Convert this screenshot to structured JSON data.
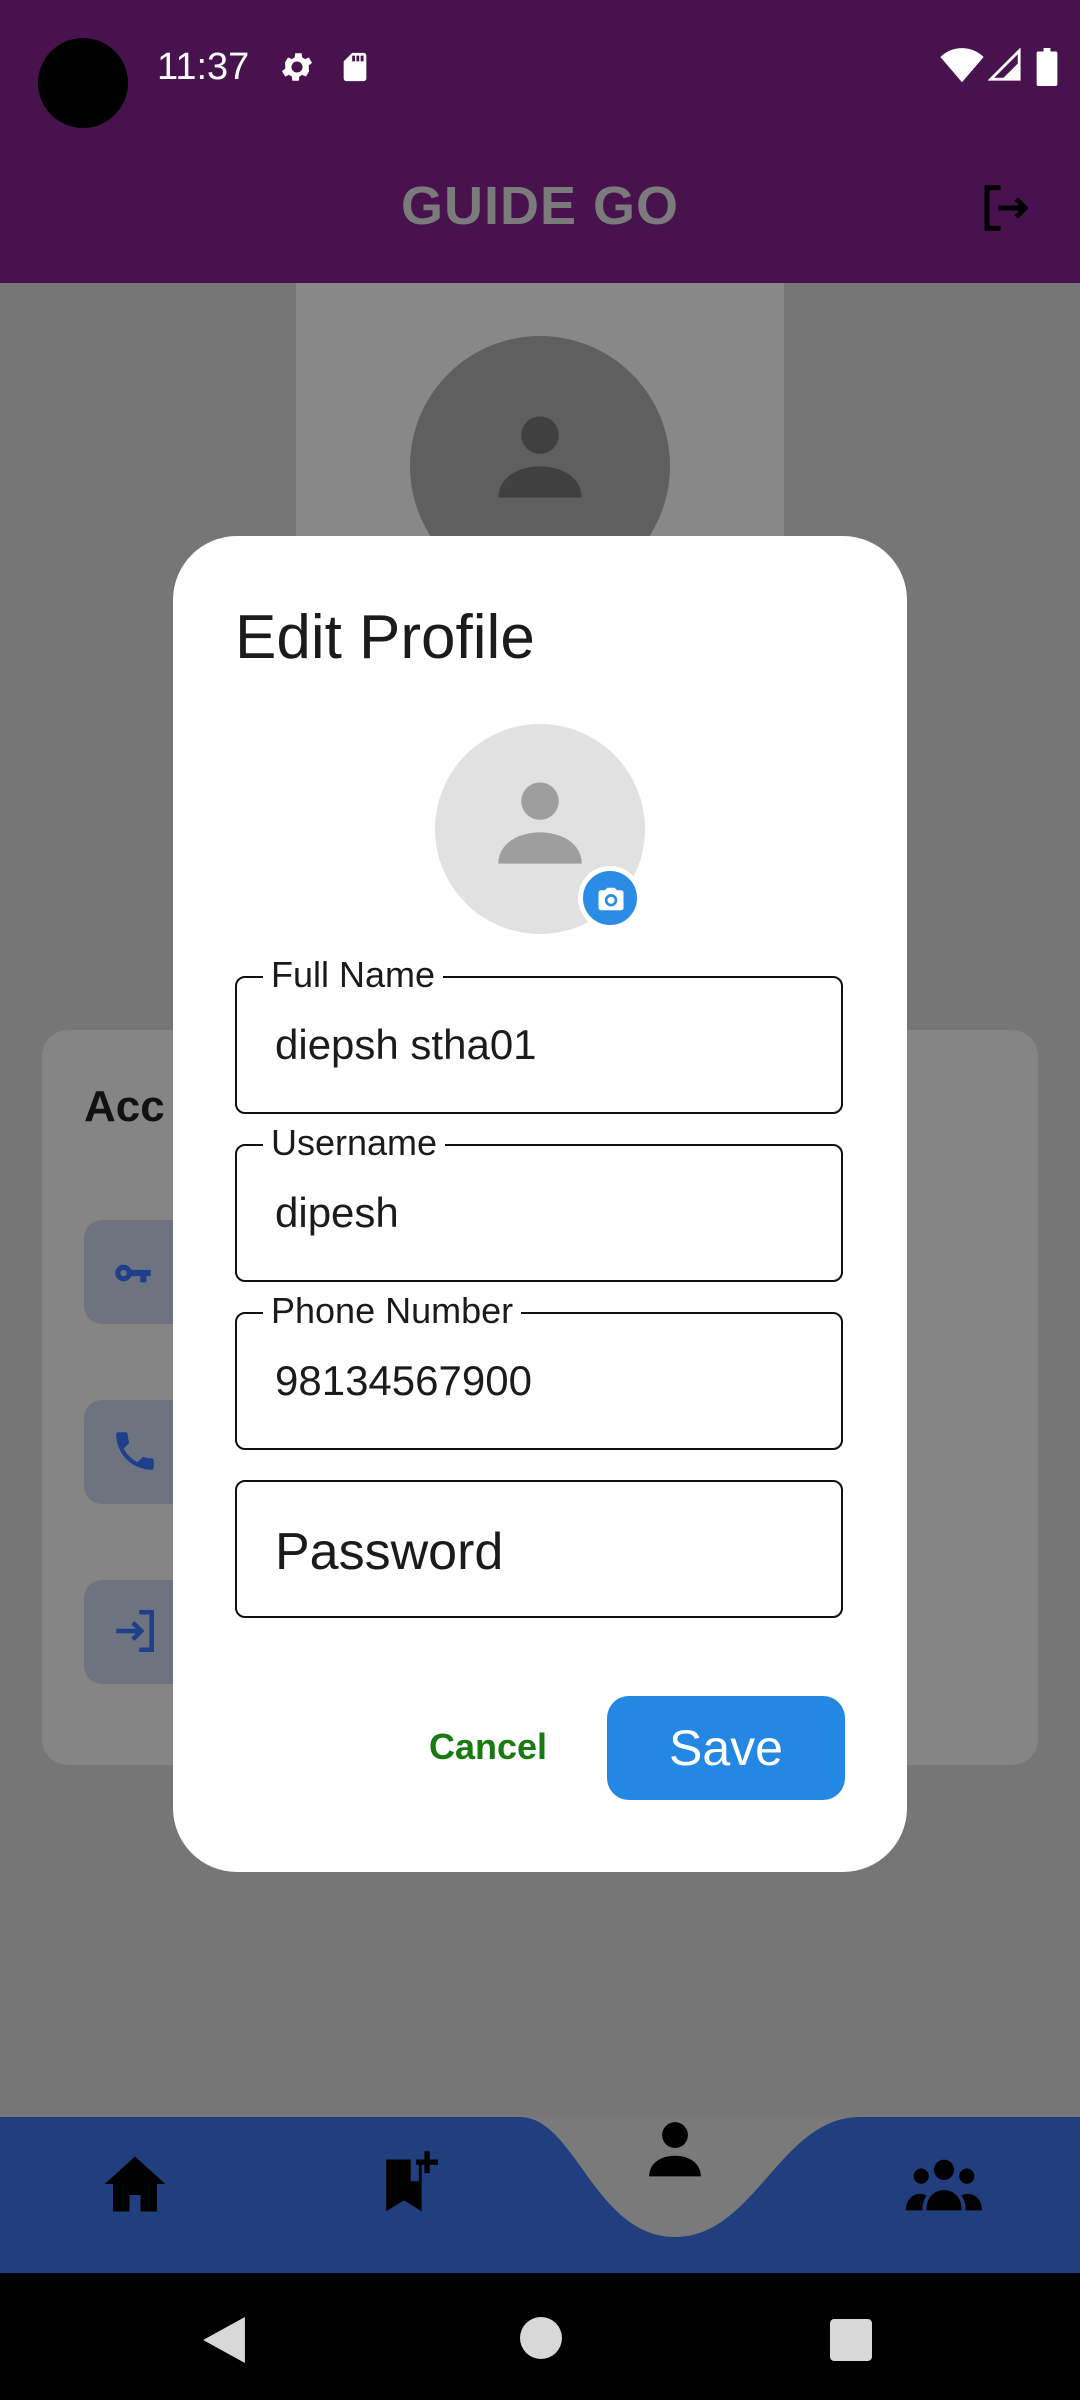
{
  "status_bar": {
    "time": "11:37",
    "icons": [
      "settings-icon",
      "sd-card-icon",
      "wifi-icon",
      "signal-icon",
      "battery-icon"
    ]
  },
  "app_bar": {
    "title": "GUIDE GO",
    "logout_icon": "logout-icon"
  },
  "background": {
    "card_title": "Acc",
    "tile_icons": [
      "key-icon",
      "phone-icon",
      "login-icon"
    ]
  },
  "dialog": {
    "title": "Edit Profile",
    "fields": {
      "full_name": {
        "label": "Full Name",
        "value": "diepsh stha01"
      },
      "username": {
        "label": "Username",
        "value": "dipesh"
      },
      "phone": {
        "label": "Phone Number",
        "value": "98134567900"
      },
      "password": {
        "placeholder": "Password"
      }
    },
    "cancel_label": "Cancel",
    "save_label": "Save"
  },
  "bottom_nav": {
    "items": [
      "home-icon",
      "bookmark-add-icon",
      "profile-icon",
      "groups-icon"
    ],
    "active": "profile-icon"
  },
  "colors": {
    "app_bar": "#48124f",
    "nav_bar": "#213f7e",
    "save_button": "#2387e3",
    "cancel_text": "#1a7a12"
  }
}
